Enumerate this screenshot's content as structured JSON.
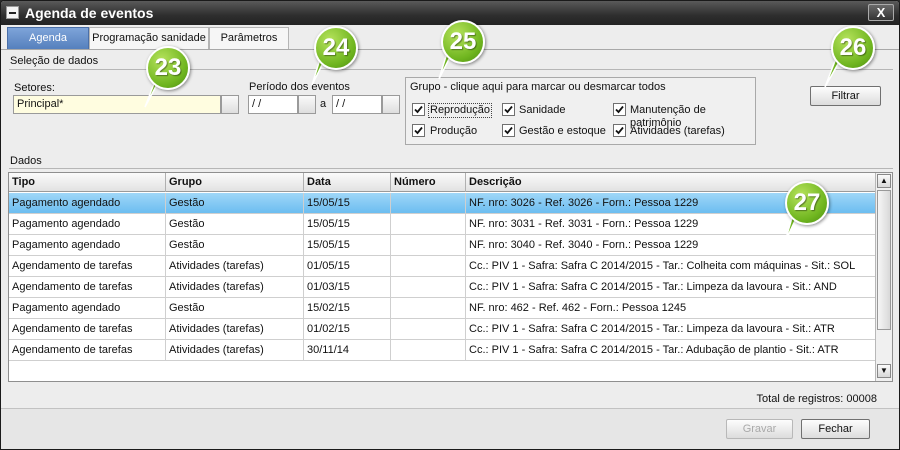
{
  "window": {
    "title": "Agenda de eventos",
    "close_label": "X"
  },
  "tabs": [
    {
      "label": "Agenda",
      "active": true
    },
    {
      "label": "Programação sanidade",
      "active": false
    },
    {
      "label": "Parâmetros",
      "active": false
    }
  ],
  "selection": {
    "section_label": "Seleção de dados",
    "setores_label": "Setores:",
    "setores_value": "Principal*",
    "periodo_label": "Período dos eventos",
    "date_from": " / /",
    "date_separator": "a",
    "date_to": " / /"
  },
  "group": {
    "title": "Grupo - clique aqui para marcar ou desmarcar todos",
    "items": [
      {
        "label": "Reprodução",
        "checked": true
      },
      {
        "label": "Sanidade",
        "checked": true
      },
      {
        "label": "Manutenção de patrimônio",
        "checked": true
      },
      {
        "label": "Produção",
        "checked": true
      },
      {
        "label": "Gestão e estoque",
        "checked": true
      },
      {
        "label": "Atividades (tarefas)",
        "checked": true
      }
    ]
  },
  "filter_button": "Filtrar",
  "data_section_label": "Dados",
  "table": {
    "columns": [
      "Tipo",
      "Grupo",
      "Data",
      "Número",
      "Descrição"
    ],
    "rows": [
      [
        "Pagamento agendado",
        "Gestão",
        "15/05/15",
        "",
        "NF. nro:  3026 - Ref. 3026 - Forn.: Pessoa 1229"
      ],
      [
        "Pagamento agendado",
        "Gestão",
        "15/05/15",
        "",
        "NF. nro:  3031 - Ref. 3031 - Forn.: Pessoa 1229"
      ],
      [
        "Pagamento agendado",
        "Gestão",
        "15/05/15",
        "",
        "NF. nro:  3040 - Ref. 3040 - Forn.: Pessoa 1229"
      ],
      [
        "Agendamento de tarefas",
        "Atividades (tarefas)",
        "01/05/15",
        "",
        "Cc.: PIV 1 - Safra: Safra C 2014/2015 - Tar.: Colheita com máquinas - Sit.: SOL"
      ],
      [
        "Agendamento de tarefas",
        "Atividades (tarefas)",
        "01/03/15",
        "",
        "Cc.: PIV 1 - Safra: Safra C 2014/2015 - Tar.: Limpeza da lavoura - Sit.: AND"
      ],
      [
        "Pagamento agendado",
        "Gestão",
        "15/02/15",
        "",
        "NF. nro:  462 - Ref. 462 - Forn.: Pessoa 1245"
      ],
      [
        "Agendamento de tarefas",
        "Atividades (tarefas)",
        "01/02/15",
        "",
        "Cc.: PIV 1 - Safra: Safra C 2014/2015 - Tar.: Limpeza da lavoura - Sit.: ATR"
      ],
      [
        "Agendamento de tarefas",
        "Atividades (tarefas)",
        "30/11/14",
        "",
        "Cc.: PIV 1 - Safra: Safra C 2014/2015 - Tar.: Adubação de plantio - Sit.: ATR"
      ]
    ],
    "selected_row": 0
  },
  "total_label": "Total de registros: 00008",
  "buttons": {
    "gravar": "Gravar",
    "fechar": "Fechar"
  },
  "callouts": [
    "23",
    "24",
    "25",
    "26",
    "27"
  ],
  "colors": {
    "accent": "#5580bd",
    "selected_row": "#8fd0f6",
    "badge": "#6fb51f"
  }
}
